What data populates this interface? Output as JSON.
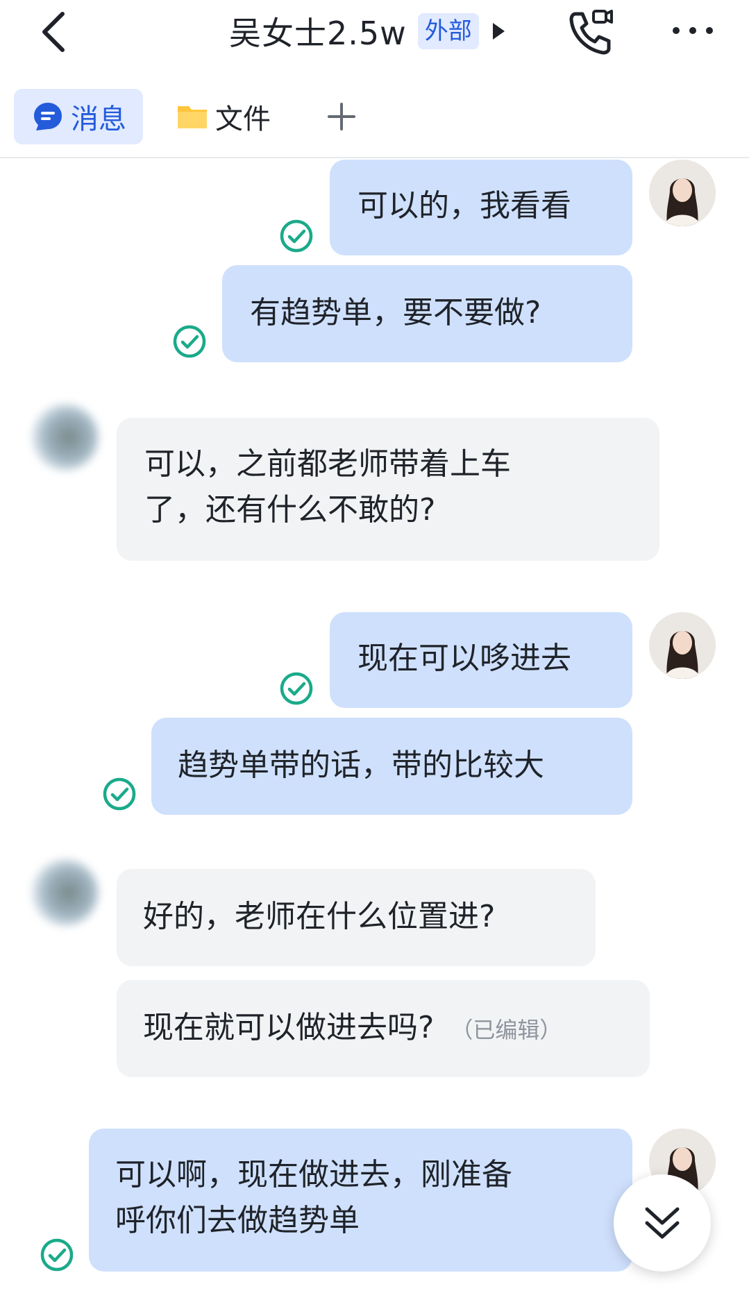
{
  "header": {
    "contact_name": "吴女士2.5w",
    "badge": "外部",
    "icons": [
      "back-icon",
      "caret-right-icon",
      "video-call-icon",
      "more-icon"
    ]
  },
  "tabs": [
    {
      "label": "消息",
      "icon": "message-icon",
      "active": true
    },
    {
      "label": "文件",
      "icon": "folder-icon",
      "active": false
    },
    {
      "label": "",
      "icon": "plus-icon",
      "active": false
    }
  ],
  "messages": [
    {
      "side": "me",
      "text": "可以的，我看看",
      "status": "read"
    },
    {
      "side": "me",
      "text": "有趋势单，要不要做?",
      "status": "read"
    },
    {
      "side": "them",
      "lines": [
        "可以，之前都老师带着上车",
        "了，还有什么不敢的?"
      ]
    },
    {
      "side": "me",
      "text": "现在可以哆进去",
      "status": "read"
    },
    {
      "side": "me",
      "text": "趋势单带的话，带的比较大",
      "status": "read"
    },
    {
      "side": "them",
      "text": "好的，老师在什么位置进?"
    },
    {
      "side": "them",
      "text": "现在就可以做进去吗?",
      "edited_label": "（已编辑）"
    },
    {
      "side": "me",
      "lines": [
        "可以啊，现在做进去，刚准备",
        "呼你们去做趋势单"
      ],
      "status": "read"
    }
  ],
  "colors": {
    "accent": "#245bdb",
    "my_bubble": "#cfe0fd",
    "their_bubble": "#f2f3f5",
    "read_check": "#1aaa8a",
    "folder": "#ffc53d"
  },
  "scroll_button": {
    "icon": "double-chevron-down-icon"
  }
}
